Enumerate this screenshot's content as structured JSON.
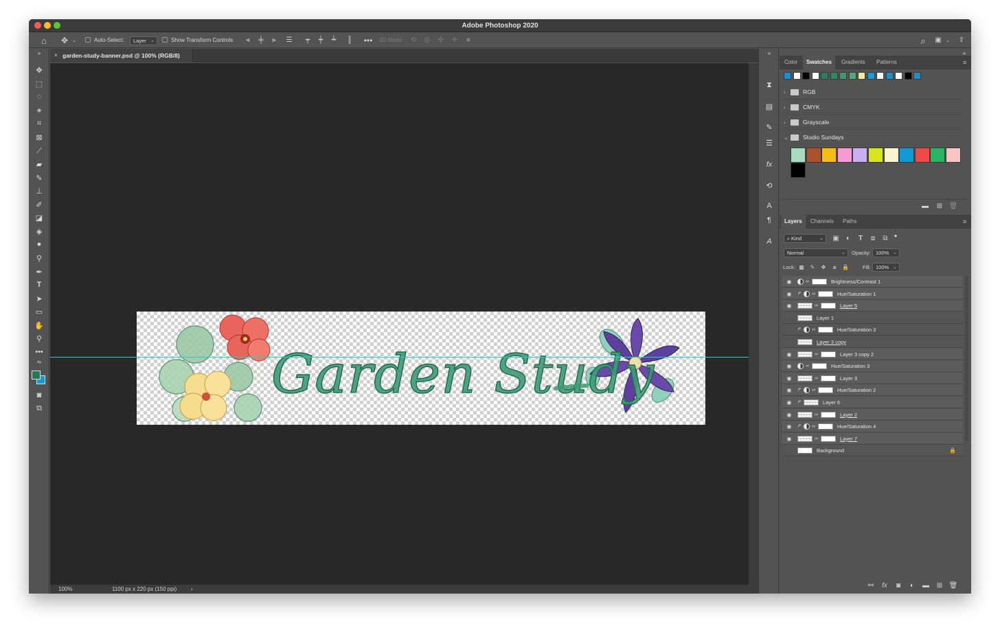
{
  "app": {
    "title": "Adobe Photoshop 2020"
  },
  "options_bar": {
    "auto_select_label": "Auto-Select:",
    "auto_select_value": "Layer",
    "show_transform_label": "Show Transform Controls",
    "mode_3d_label": "3D Mode:"
  },
  "document": {
    "tab_label": "garden-study-banner.psd @ 100% (RGB/8)",
    "artwork_text": "Garden Study"
  },
  "status": {
    "zoom": "100%",
    "doc_info": "1100 px x 220 px (150 ppi)"
  },
  "swatches_panel": {
    "tabs": [
      "Color",
      "Swatches",
      "Gradients",
      "Patterns"
    ],
    "active_tab": "Swatches",
    "recent_colors": [
      "#1a8fd0",
      "#ffffff",
      "#000000",
      "#ffffff",
      "#2f7d5c",
      "#2f8a63",
      "#3a9a72",
      "#4aae85",
      "#f2ea9c",
      "#1f9ad4",
      "#ffffff",
      "#1a8fd0",
      "#ffffff",
      "#000000",
      "#1a8fd0"
    ],
    "groups": [
      "RGB",
      "CMYK",
      "Grayscale",
      "Studio Sundays"
    ],
    "studio_sundays_colors": [
      "#a8dbbf",
      "#a8522f",
      "#f5bd13",
      "#f69bd1",
      "#c9aef0",
      "#d6e51c",
      "#faf3d0",
      "#1599d4",
      "#ef4a4a",
      "#2ab463",
      "#f9c5c6",
      "#000000"
    ]
  },
  "layers_panel": {
    "tabs": [
      "Layers",
      "Channels",
      "Paths"
    ],
    "active_tab": "Layers",
    "filter_kind": "Kind",
    "blend_mode": "Normal",
    "opacity_label": "Opacity:",
    "opacity_value": "100%",
    "lock_label": "Lock:",
    "fill_label": "Fill:",
    "fill_value": "100%",
    "layers": [
      {
        "name": "Brightness/Contrast 1",
        "visible": true,
        "type": "adjustment",
        "clipped": false,
        "underlined": false
      },
      {
        "name": "Hue/Saturation 1",
        "visible": true,
        "type": "adjustment",
        "clipped": true,
        "underlined": false
      },
      {
        "name": "Layer 5",
        "visible": true,
        "type": "pixel-mask",
        "clipped": false,
        "underlined": true
      },
      {
        "name": "Layer 1",
        "visible": false,
        "type": "pixel",
        "clipped": false,
        "underlined": false
      },
      {
        "name": "Hue/Saturation 3",
        "visible": false,
        "type": "adjustment",
        "clipped": true,
        "underlined": false
      },
      {
        "name": "Layer 3 copy",
        "visible": false,
        "type": "pixel",
        "clipped": false,
        "underlined": true
      },
      {
        "name": "Layer 3 copy 2",
        "visible": true,
        "type": "pixel-mask",
        "clipped": false,
        "underlined": false
      },
      {
        "name": "Hue/Saturation 3",
        "visible": true,
        "type": "adjustment",
        "clipped": false,
        "underlined": false
      },
      {
        "name": "Layer 3",
        "visible": true,
        "type": "pixel-mask",
        "clipped": false,
        "underlined": false
      },
      {
        "name": "Hue/Saturation 2",
        "visible": true,
        "type": "adjustment",
        "clipped": true,
        "underlined": false
      },
      {
        "name": "Layer 6",
        "visible": true,
        "type": "pixel",
        "clipped": true,
        "underlined": false
      },
      {
        "name": "Layer 2",
        "visible": true,
        "type": "pixel-mask",
        "clipped": false,
        "underlined": true
      },
      {
        "name": "Hue/Saturation 4",
        "visible": true,
        "type": "adjustment",
        "clipped": true,
        "underlined": false
      },
      {
        "name": "Layer 7",
        "visible": true,
        "type": "pixel-mask",
        "clipped": false,
        "underlined": true
      },
      {
        "name": "Background",
        "visible": false,
        "type": "background",
        "clipped": false,
        "underlined": false
      }
    ]
  },
  "colors": {
    "foreground": "#1f7a5a",
    "background": "#1599d4",
    "guide": "#35c6c6",
    "lettering": "#3d9a76"
  }
}
